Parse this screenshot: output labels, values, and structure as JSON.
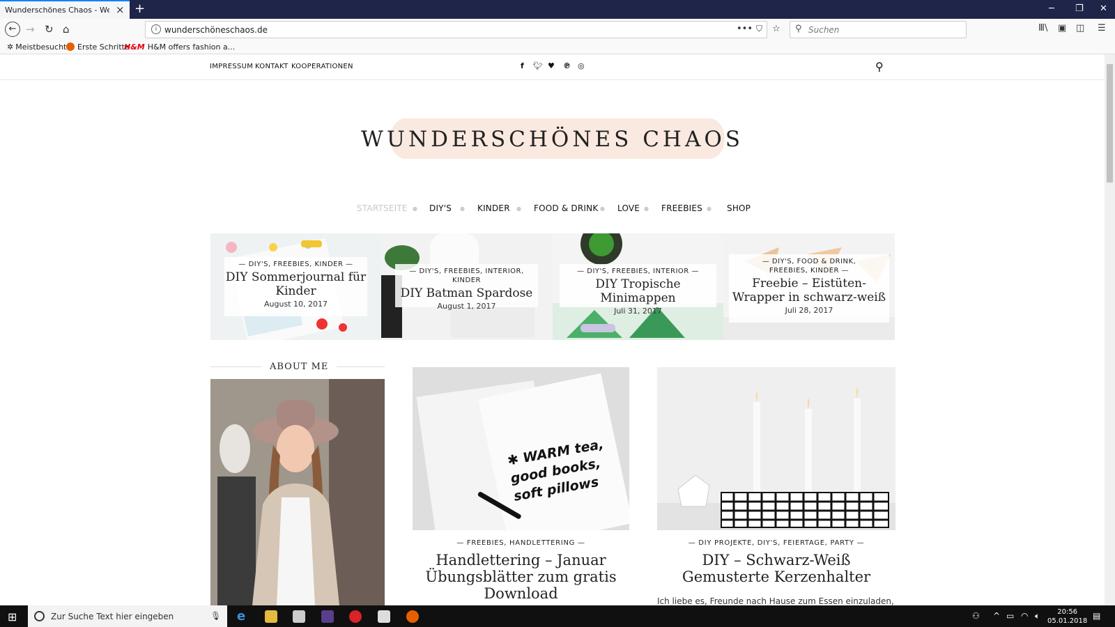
{
  "browser": {
    "tab_title": "Wunderschönes Chaos - Werde mi",
    "new_tab": "+",
    "url": "wunderschöneschaos.de",
    "search_placeholder": "Suchen",
    "bookmarks": [
      "Meistbesucht",
      "Erste Schritte",
      "H&M offers fashion a..."
    ]
  },
  "site": {
    "topnav": [
      "IMPRESSUM",
      "KONTAKT",
      "KOOPERATIONEN"
    ],
    "social_icons": [
      "facebook-icon",
      "twitter-icon",
      "heart-icon",
      "pinterest-icon",
      "instagram-icon"
    ],
    "logo": "WUNDERSCHÖNES CHAOS",
    "menu": [
      "STARTSEITE",
      "DIY'S",
      "KINDER",
      "FOOD & DRINK",
      "LOVE",
      "FREEBIES",
      "SHOP"
    ],
    "menu_active_color": "#c8c8c8",
    "slider": [
      {
        "cats": "— DIY'S, FREEBIES, KINDER —",
        "title": "DIY Sommerjournal für Kinder",
        "date": "August 10, 2017"
      },
      {
        "cats": "— DIY'S, FREEBIES, INTERIOR, KINDER",
        "title": "DIY Batman Spardose",
        "date": "August 1, 2017"
      },
      {
        "cats": "— DIY'S, FREEBIES, INTERIOR —",
        "title": "DIY Tropische Minimappen",
        "date": "Juli 31, 2017"
      },
      {
        "cats": "— DIY'S, FOOD & DRINK, FREEBIES, KINDER —",
        "title": "Freebie – Eistüten-Wrapper in schwarz-weiß",
        "date": "Juli 28, 2017"
      }
    ],
    "about_title": "ABOUT ME",
    "posts": [
      {
        "cats": "— FREEBIES, HANDLETTERING —",
        "title": "Handlettering – Januar Übungsblätter zum gratis Download",
        "excerpt": "",
        "image_text": "WARM tea, good books, soft pillows"
      },
      {
        "cats": "— DIY PROJEKTE, DIY'S, FEIERTAGE, PARTY —",
        "title": "DIY – Schwarz-Weiß Gemusterte Kerzenhalter",
        "excerpt": "Ich liebe es, Freunde nach Hause zum Essen einzuladen,"
      }
    ]
  },
  "taskbar": {
    "search_placeholder": "Zur Suche Text hier eingeben",
    "time": "20:56",
    "date": "05.01.2018"
  }
}
